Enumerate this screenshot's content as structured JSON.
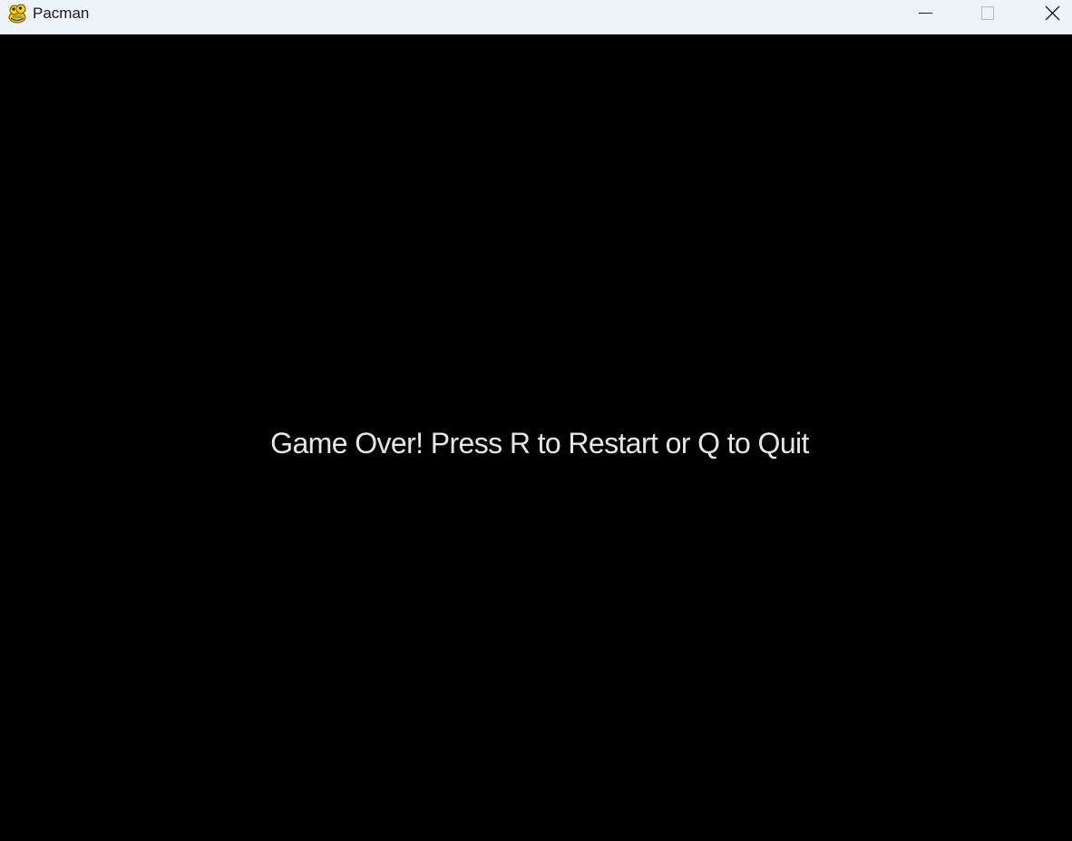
{
  "window": {
    "title": "Pacman",
    "icon": "pygame-snake-icon",
    "controls": {
      "minimize_icon": "minimize-icon",
      "maximize_icon": "maximize-icon",
      "close_icon": "close-icon"
    }
  },
  "game": {
    "background_color": "#000000",
    "message_color": "#e6e6e6",
    "message": "Game Over! Press R to Restart or Q to Quit"
  }
}
